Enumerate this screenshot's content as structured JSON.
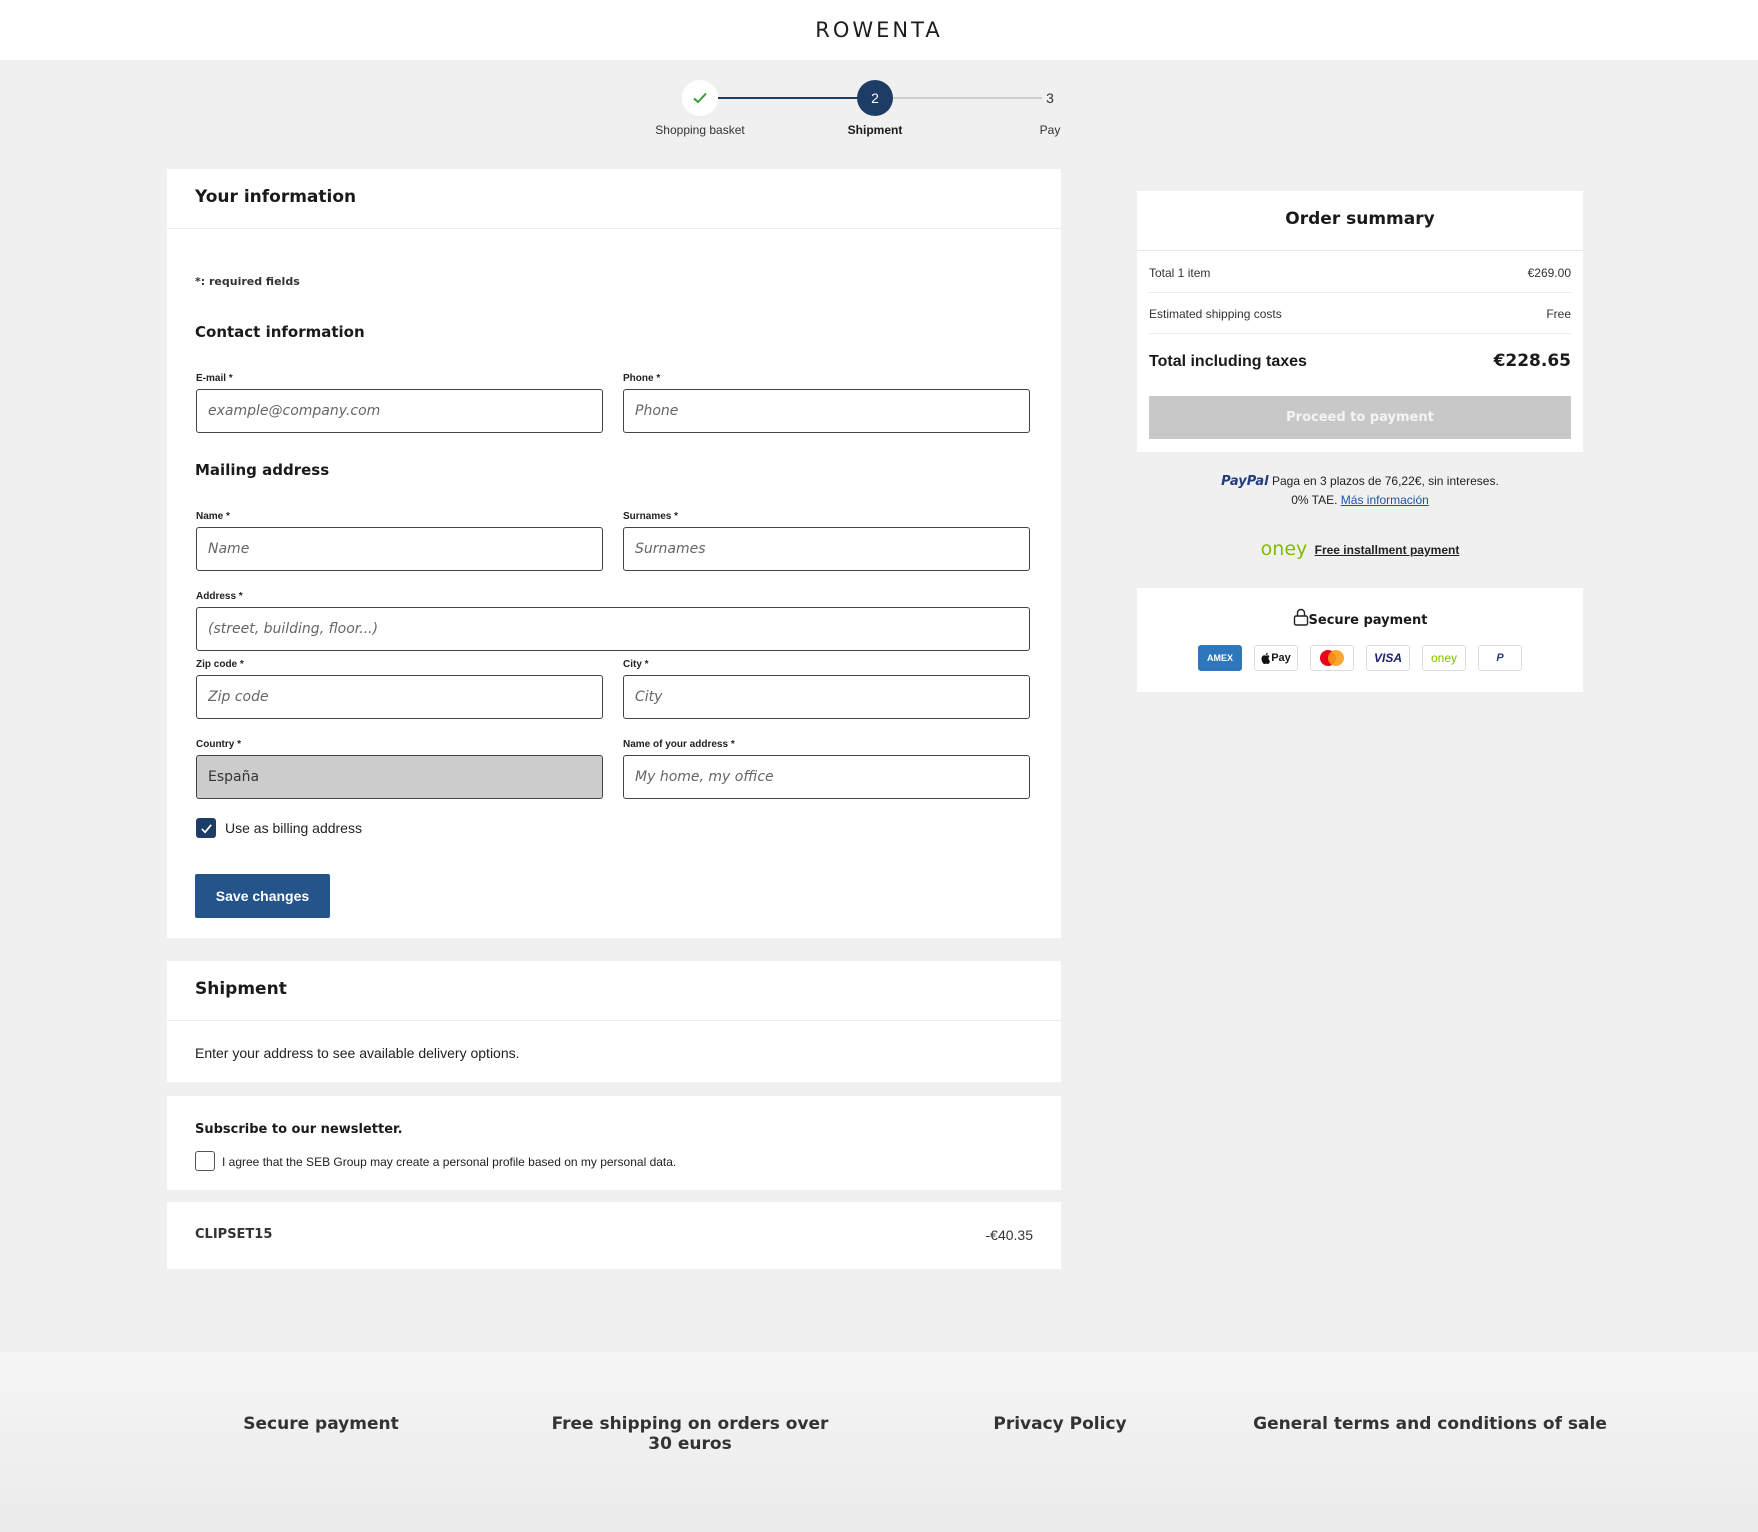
{
  "header": {
    "logo": "ROWENTA"
  },
  "stepper": {
    "steps": [
      {
        "label": "Shopping basket",
        "number": ""
      },
      {
        "label": "Shipment",
        "number": "2"
      },
      {
        "label": "Pay",
        "number": "3"
      }
    ]
  },
  "info": {
    "title": "Your information",
    "required_note": "*: required fields",
    "contact_title": "Contact information",
    "mailing_title": "Mailing address",
    "fields": {
      "email": {
        "label": "E-mail *",
        "placeholder": "example@company.com"
      },
      "phone": {
        "label": "Phone *",
        "placeholder": "Phone"
      },
      "name": {
        "label": "Name *",
        "placeholder": "Name"
      },
      "surnames": {
        "label": "Surnames *",
        "placeholder": "Surnames"
      },
      "address": {
        "label": "Address *",
        "placeholder": "(street, building, floor...)"
      },
      "zip": {
        "label": "Zip code *",
        "placeholder": "Zip code"
      },
      "city": {
        "label": "City *",
        "placeholder": "City"
      },
      "country": {
        "label": "Country *",
        "value": "España"
      },
      "address_name": {
        "label": "Name of your address *",
        "placeholder": "My home, my office"
      }
    },
    "billing_label": "Use as billing address",
    "save_label": "Save changes"
  },
  "shipment": {
    "title": "Shipment",
    "text": "Enter your address to see available delivery options."
  },
  "newsletter": {
    "title": "Subscribe to our newsletter.",
    "consent": "I agree that the SEB Group may create a personal profile based on my personal data."
  },
  "coupon": {
    "code": "CLIPSET15",
    "amount": "-€40.35"
  },
  "summary": {
    "title": "Order summary",
    "items_label": "Total 1 item",
    "items_value": "€269.00",
    "shipping_label": "Estimated shipping costs",
    "shipping_value": "Free",
    "total_label": "Total including taxes",
    "total_value": "€228.65",
    "pay_label": "Proceed to payment"
  },
  "paypal": {
    "logo": "PayPal",
    "text1": "Paga en 3 plazos de 76,22€, sin intereses.",
    "text2": "0% TAE.",
    "link": "Más información"
  },
  "oney": {
    "logo": "oney",
    "link": "Free installment payment"
  },
  "secure": {
    "title": "Secure payment",
    "methods": [
      "AMEX",
      "Pay",
      "",
      "VISA",
      "oney",
      "P"
    ]
  },
  "footer": {
    "links": [
      "Secure payment",
      "Free shipping on orders over 30 euros",
      "Privacy Policy",
      "General terms and conditions of sale"
    ]
  },
  "colors": {
    "primary": "#1e3d66",
    "button": "#24548a",
    "oney": "#81bc00"
  }
}
